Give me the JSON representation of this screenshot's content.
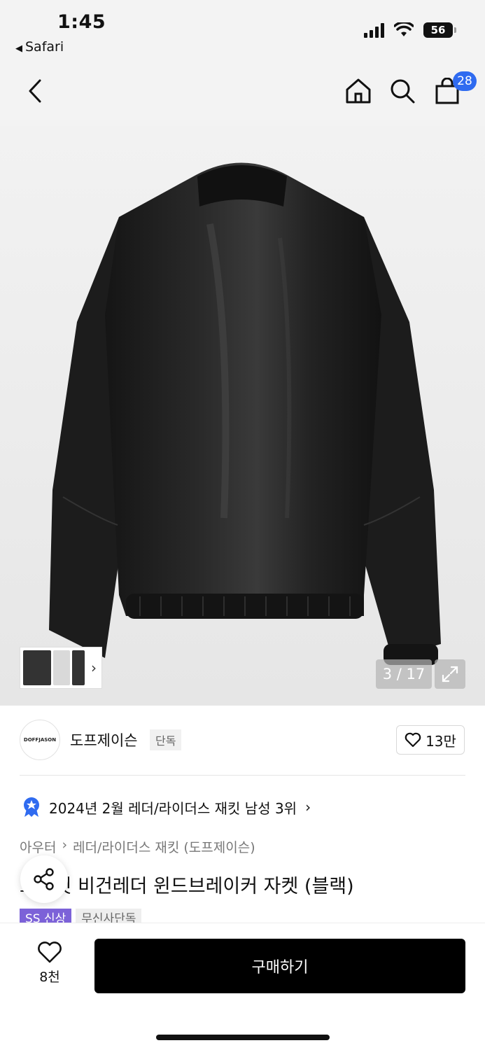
{
  "status_bar": {
    "time": "1:45",
    "back_app": "Safari",
    "battery": "56"
  },
  "header": {
    "back_icon": "chevron-left-icon",
    "home_icon": "home-icon",
    "search_icon": "search-icon",
    "cart_icon": "bag-icon",
    "cart_count": "28"
  },
  "gallery": {
    "counter": "3 / 17",
    "thumb_arrow": "›"
  },
  "brand": {
    "logo_text": "DOFFJASON",
    "name": "도프제이슨",
    "tag": "단독",
    "likes": "13만"
  },
  "ranking": {
    "text": "2024년 2월 레더/라이더스 재킷 남성 3위",
    "chevron": "›"
  },
  "breadcrumb": {
    "category": "아우터",
    "separator": "›",
    "subcategory": "레더/라이더스 재킷 (도프제이슨)"
  },
  "product": {
    "title": "오버핏 비건레더 윈드브레이커 자켓 (블랙)",
    "tags": [
      "SS 신상",
      "무신사단독"
    ]
  },
  "bottom": {
    "wish_count": "8천",
    "buy_label": "구매하기"
  }
}
